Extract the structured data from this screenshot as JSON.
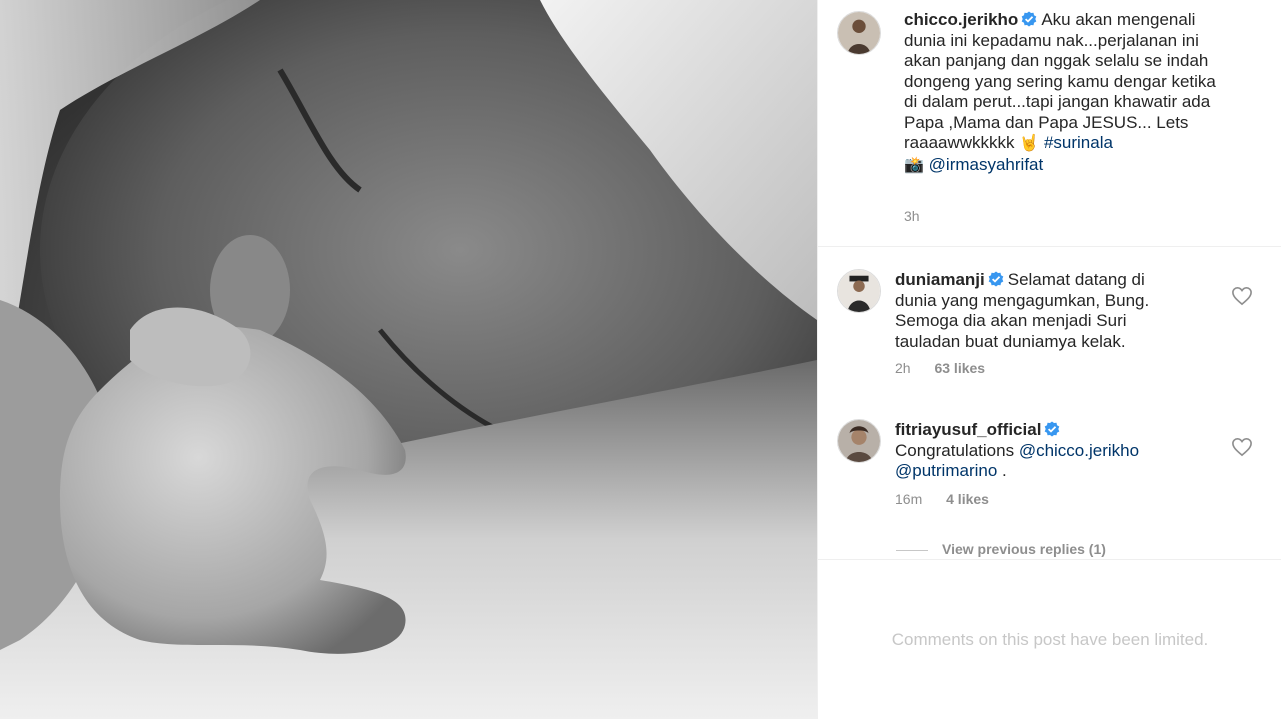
{
  "post": {
    "author": "chicco.jerikho",
    "caption": "Aku akan mengenali dunia ini kepadamu nak...perjalanan ini akan panjang dan nggak selalu se indah dongeng yang sering kamu dengar ketika di dalam perut...tapi jangan khawatir ada Papa ,Mama dan Papa JESUS... Lets raaaawwkkkkk",
    "hashtag": "#surinala",
    "photo_credit": "@irmasyahrifat",
    "time": "3h",
    "rock_emoji": "🤘",
    "camera_emoji": "📸"
  },
  "comments": [
    {
      "author": "duniamanji",
      "text": "Selamat datang di dunia yang mengagumkan, Bung. Semoga dia akan menjadi Suri tauladan buat duniamya kelak.",
      "time": "2h",
      "likes": "63 likes"
    },
    {
      "author": "fitriayusuf_official",
      "text_prefix": "Congratulations",
      "mention1": "@chicco.jerikho",
      "mention2": "@putrimarino",
      "text_suffix": " .",
      "time": "16m",
      "likes": "4 likes",
      "view_replies": "View previous replies (1)"
    }
  ],
  "footer": {
    "limited_notice": "Comments on this post have been limited."
  },
  "colors": {
    "link": "#003569",
    "verified": "#3897f0",
    "meta": "#8e8e8e"
  }
}
